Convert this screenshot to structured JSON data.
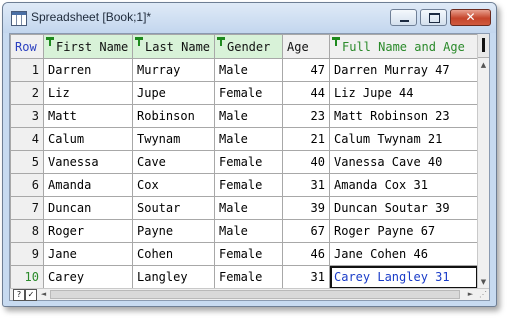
{
  "window": {
    "title": "Spreadsheet [Book;1]*",
    "close_glyph": "✕"
  },
  "grid": {
    "rownum_header": "Row",
    "columns": [
      {
        "label": "First Name",
        "key": true
      },
      {
        "label": "Last Name",
        "key": true
      },
      {
        "label": "Gender",
        "key": true
      },
      {
        "label": "Age",
        "key": false
      },
      {
        "label": "Full Name and Age",
        "formula": true
      }
    ],
    "rows": [
      {
        "n": "1",
        "first": "Darren",
        "last": "Murray",
        "gender": "Male",
        "age": "47",
        "full": "Darren Murray 47"
      },
      {
        "n": "2",
        "first": "Liz",
        "last": "Jupe",
        "gender": "Female",
        "age": "44",
        "full": "Liz Jupe 44"
      },
      {
        "n": "3",
        "first": "Matt",
        "last": "Robinson",
        "gender": "Male",
        "age": "23",
        "full": "Matt Robinson 23"
      },
      {
        "n": "4",
        "first": "Calum",
        "last": "Twynam",
        "gender": "Male",
        "age": "21",
        "full": "Calum Twynam 21"
      },
      {
        "n": "5",
        "first": "Vanessa",
        "last": "Cave",
        "gender": "Female",
        "age": "40",
        "full": "Vanessa Cave 40"
      },
      {
        "n": "6",
        "first": "Amanda",
        "last": "Cox",
        "gender": "Female",
        "age": "31",
        "full": "Amanda Cox 31"
      },
      {
        "n": "7",
        "first": "Duncan",
        "last": "Soutar",
        "gender": "Male",
        "age": "39",
        "full": "Duncan Soutar 39"
      },
      {
        "n": "8",
        "first": "Roger",
        "last": "Payne",
        "gender": "Male",
        "age": "67",
        "full": "Roger Payne 67"
      },
      {
        "n": "9",
        "first": "Jane",
        "last": "Cohen",
        "gender": "Female",
        "age": "46",
        "full": "Jane Cohen 46"
      },
      {
        "n": "10",
        "first": "Carey",
        "last": "Langley",
        "gender": "Female",
        "age": "31",
        "full": "Carey Langley 31"
      }
    ],
    "selected_row": "10",
    "selected_column": "Full Name and Age"
  },
  "statusbar": {
    "help_glyph": "?",
    "check_glyph": "✓",
    "left_arrow": "◄",
    "right_arrow": "►"
  },
  "scroll": {
    "up_arrow": "▲",
    "down_arrow": "▼"
  },
  "colors": {
    "key_header_bg": "#d8f2d8",
    "formula_header_text": "#2a8a2a",
    "selected_cell_text": "#1a3cc8",
    "rownum_header_text": "#2b3fc0",
    "close_button": "#c5452b"
  }
}
